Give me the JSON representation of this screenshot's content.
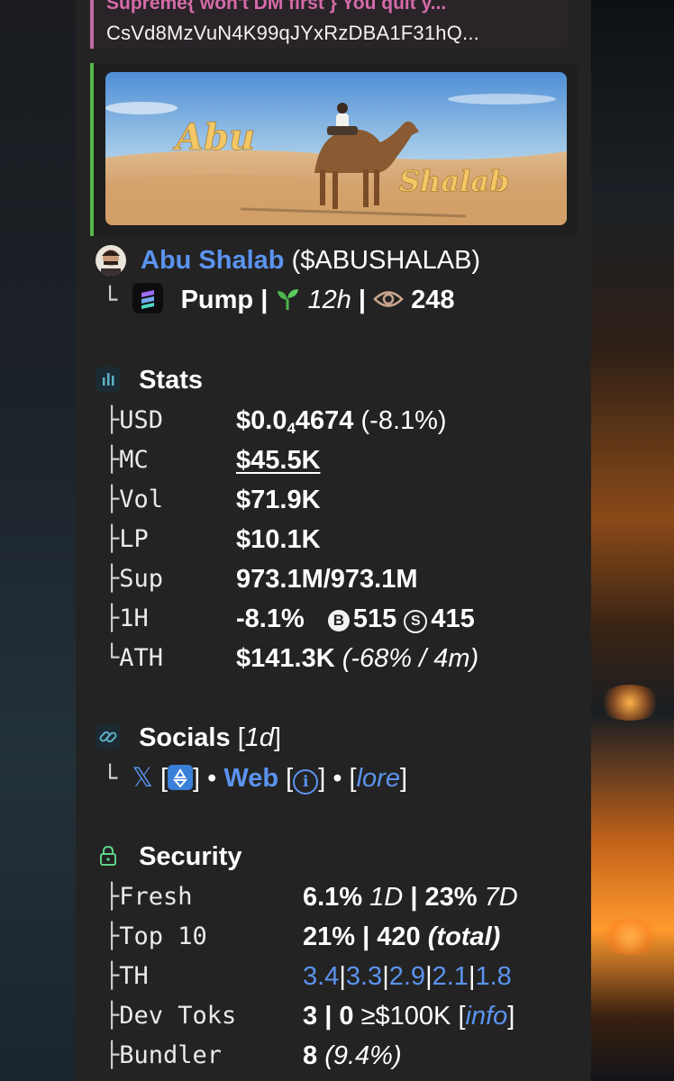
{
  "reply": {
    "snippet": "Supreme{ won't DM first } You quit y...",
    "address": "CsVd8MzVuN4K99qJYxRzDBA1F31hQ..."
  },
  "banner": {
    "word1": "Abu",
    "word2": "Shalab"
  },
  "token": {
    "name": "Abu Shalab",
    "ticker": "($ABUSHALAB)",
    "platform": "Pump",
    "age": "12h",
    "views": "248"
  },
  "stats": {
    "title": "Stats",
    "usd_label": "USD",
    "usd_main": "$0.0",
    "usd_sub": "4",
    "usd_tail": "4674",
    "usd_change": "(-8.1%)",
    "mc_label": "MC",
    "mc_value": "$45.5K",
    "vol_label": "Vol",
    "vol_value": "$71.9K",
    "lp_label": "LP",
    "lp_value": "$10.1K",
    "sup_label": "Sup",
    "sup_value": "973.1M/973.1M",
    "h1_label": "1H",
    "h1_change": "-8.1%",
    "h1_buys_badge": "B",
    "h1_buys": "515",
    "h1_sells_badge": "S",
    "h1_sells": "415",
    "ath_label": "ATH",
    "ath_value": "$141.3K",
    "ath_note": "(-68% / 4m)"
  },
  "socials": {
    "title": "Socials",
    "age": "1d",
    "x_label": "𝕏",
    "web_label": "Web",
    "lore_label": "lore"
  },
  "security": {
    "title": "Security",
    "fresh_label": "Fresh",
    "fresh_1d": "6.1%",
    "fresh_1d_tag": "1D",
    "fresh_7d": "23%",
    "fresh_7d_tag": "7D",
    "top10_label": "Top 10",
    "top10_pct": "21%",
    "top10_count": "420",
    "top10_tag": "(total)",
    "th_label": "TH",
    "th_values": [
      "3.4",
      "3.3",
      "2.9",
      "2.1",
      "1.8"
    ],
    "devtoks_label": "Dev Toks",
    "devtoks_a": "3",
    "devtoks_b": "0",
    "devtoks_threshold": "≥$100K",
    "devtoks_info": "info",
    "bundler_label": "Bundler",
    "bundler_count": "8",
    "bundler_pct": "(9.4%)"
  },
  "colors": {
    "panel": "#232323",
    "link_blue": "#5b93ef",
    "reply_accent": "#c06aa0",
    "banner_accent": "#56b84a"
  }
}
